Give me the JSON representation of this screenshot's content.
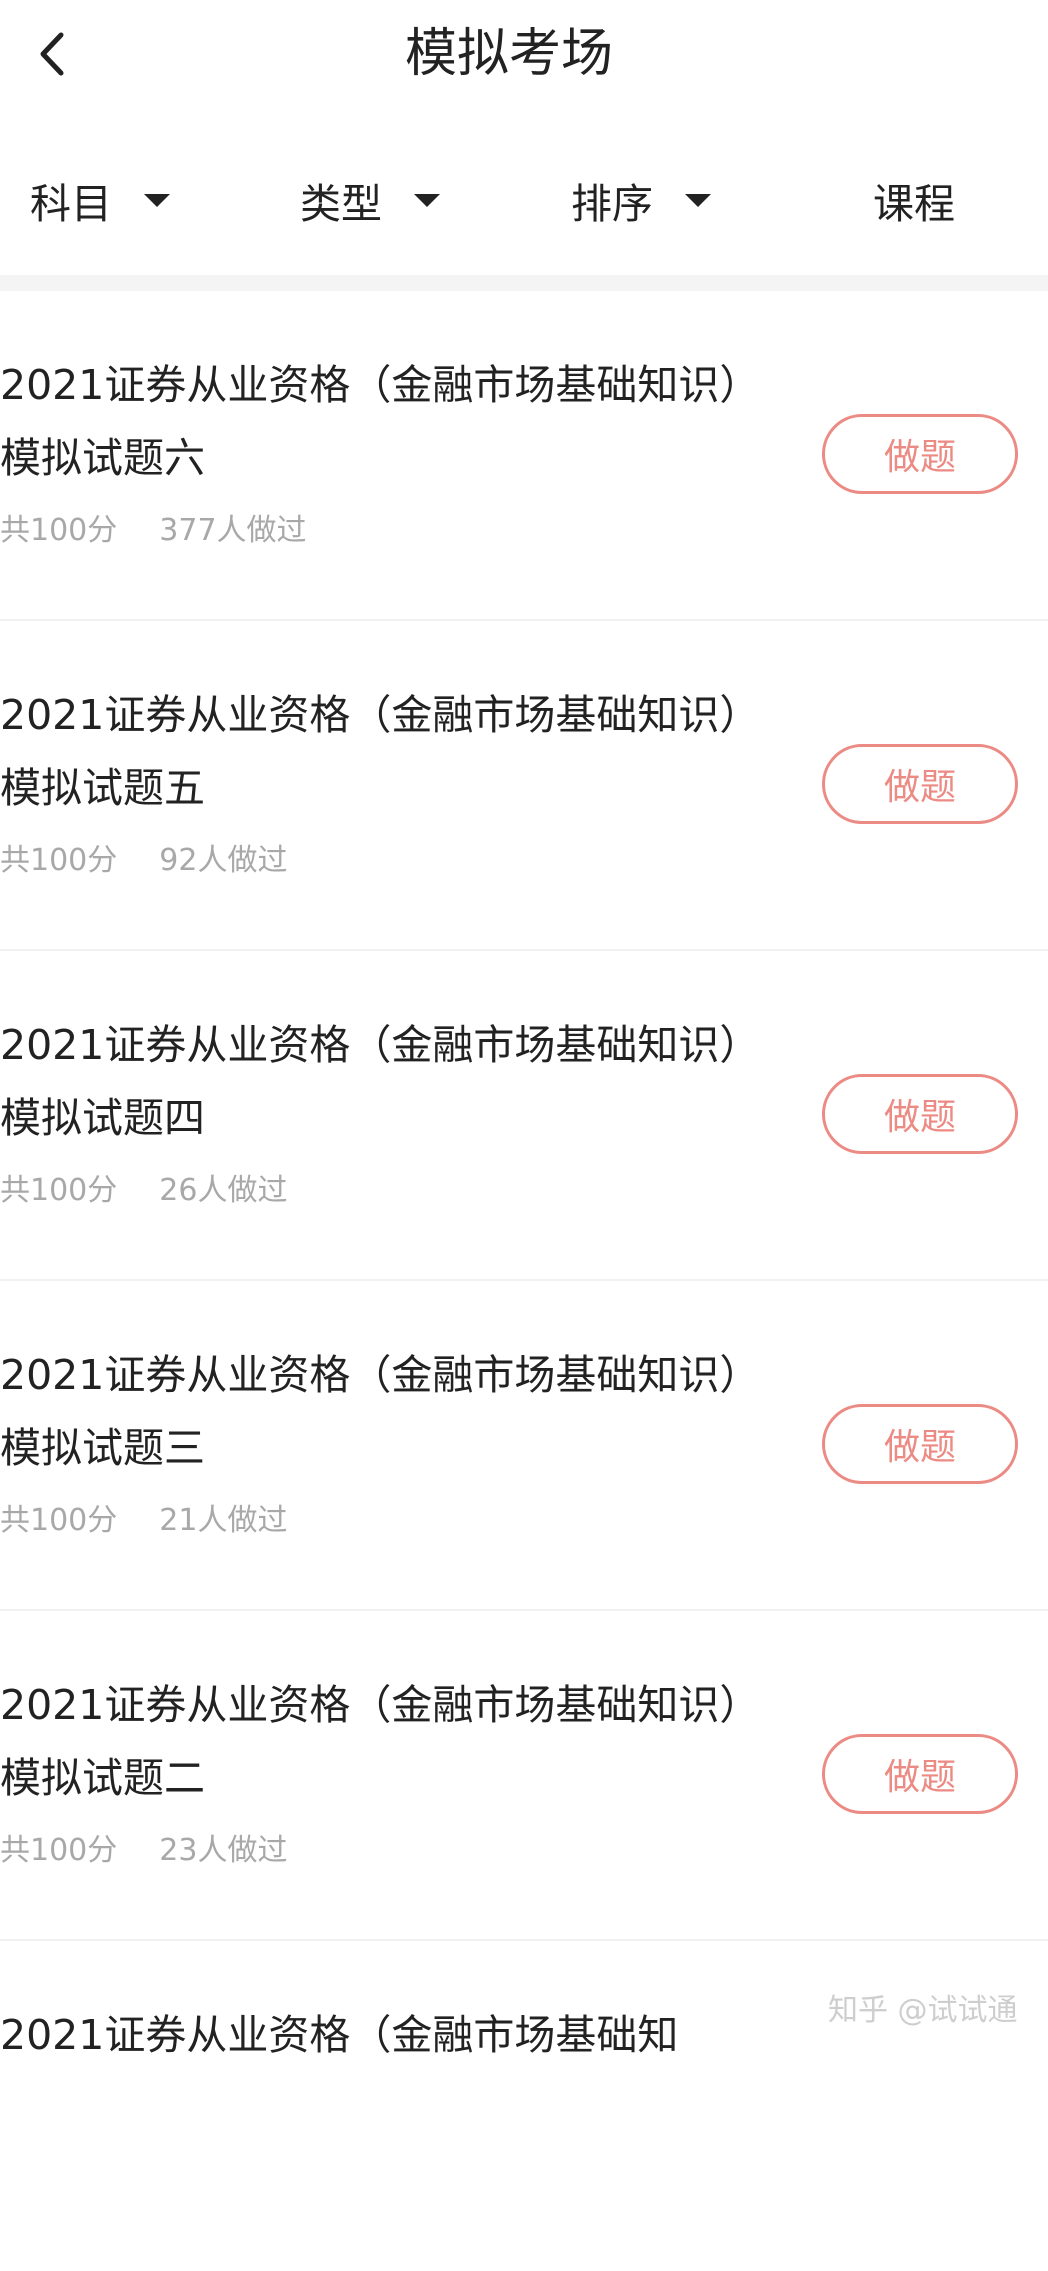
{
  "header": {
    "title": "模拟考场"
  },
  "filters": [
    {
      "label": "科目",
      "has_caret": true
    },
    {
      "label": "类型",
      "has_caret": true
    },
    {
      "label": "排序",
      "has_caret": true
    },
    {
      "label": "课程",
      "has_caret": false
    }
  ],
  "exams": [
    {
      "title": "2021证券从业资格（金融市场基础知识）模拟试题六",
      "score": "共100分",
      "takers": "377人做过",
      "button": "做题"
    },
    {
      "title": "2021证券从业资格（金融市场基础知识）模拟试题五",
      "score": "共100分",
      "takers": "92人做过",
      "button": "做题"
    },
    {
      "title": "2021证券从业资格（金融市场基础知识）模拟试题四",
      "score": "共100分",
      "takers": "26人做过",
      "button": "做题"
    },
    {
      "title": "2021证券从业资格（金融市场基础知识）模拟试题三",
      "score": "共100分",
      "takers": "21人做过",
      "button": "做题"
    },
    {
      "title": "2021证券从业资格（金融市场基础知识）模拟试题二",
      "score": "共100分",
      "takers": "23人做过",
      "button": "做题"
    },
    {
      "title": "2021证券从业资格（金融市场基础知",
      "score": "",
      "takers": "",
      "button": ""
    }
  ],
  "watermark": "知乎 @试试通",
  "colors": {
    "accent": "#ec8a84",
    "text": "#222222",
    "muted": "#a8a8a8",
    "band": "#f4f4f4"
  },
  "icons": {
    "back": "chevron-left-icon",
    "filter_caret": "caret-down-icon"
  }
}
